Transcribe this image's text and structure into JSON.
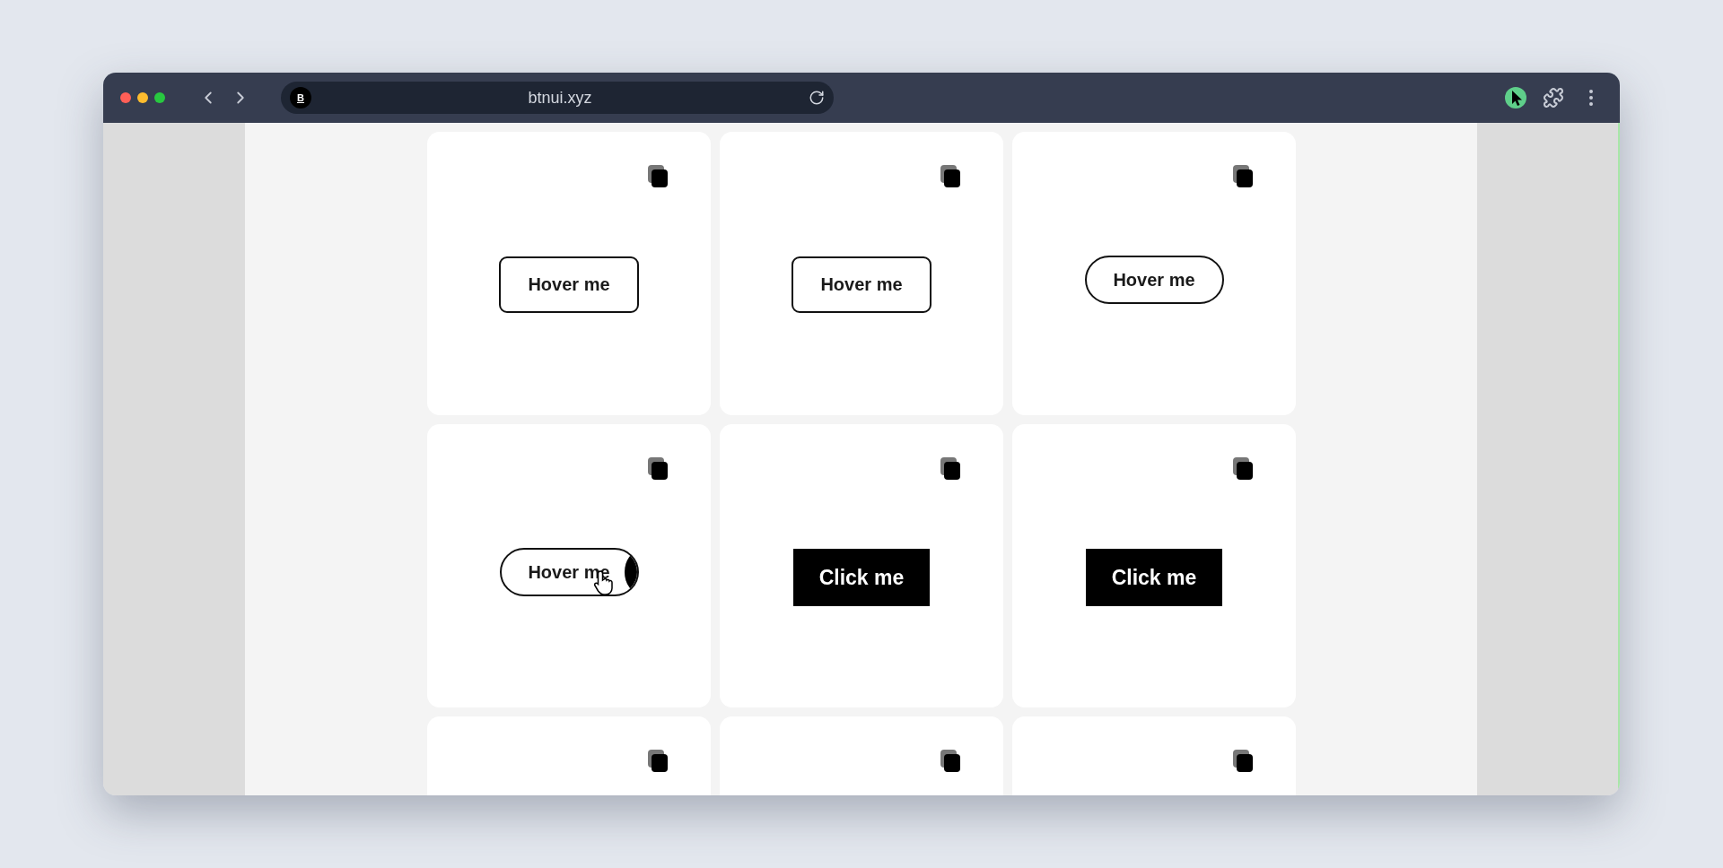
{
  "browser": {
    "favicon_letter": "B",
    "url": "btnui.xyz"
  },
  "cards": [
    {
      "copy_icon": true,
      "button": {
        "kind": "rounded",
        "label": "Hover me",
        "hovered": false
      }
    },
    {
      "copy_icon": true,
      "button": {
        "kind": "rounded",
        "label": "Hover me",
        "hovered": false
      }
    },
    {
      "copy_icon": true,
      "button": {
        "kind": "pill",
        "label": "Hover me",
        "hovered": false
      }
    },
    {
      "copy_icon": true,
      "button": {
        "kind": "pill",
        "label": "Hover me",
        "hovered": true
      }
    },
    {
      "copy_icon": true,
      "button": {
        "kind": "solid",
        "label": "Click me",
        "hovered": false
      }
    },
    {
      "copy_icon": true,
      "button": {
        "kind": "solid",
        "label": "Click me",
        "hovered": false
      }
    },
    {
      "copy_icon": true
    },
    {
      "copy_icon": true
    },
    {
      "copy_icon": true
    }
  ]
}
